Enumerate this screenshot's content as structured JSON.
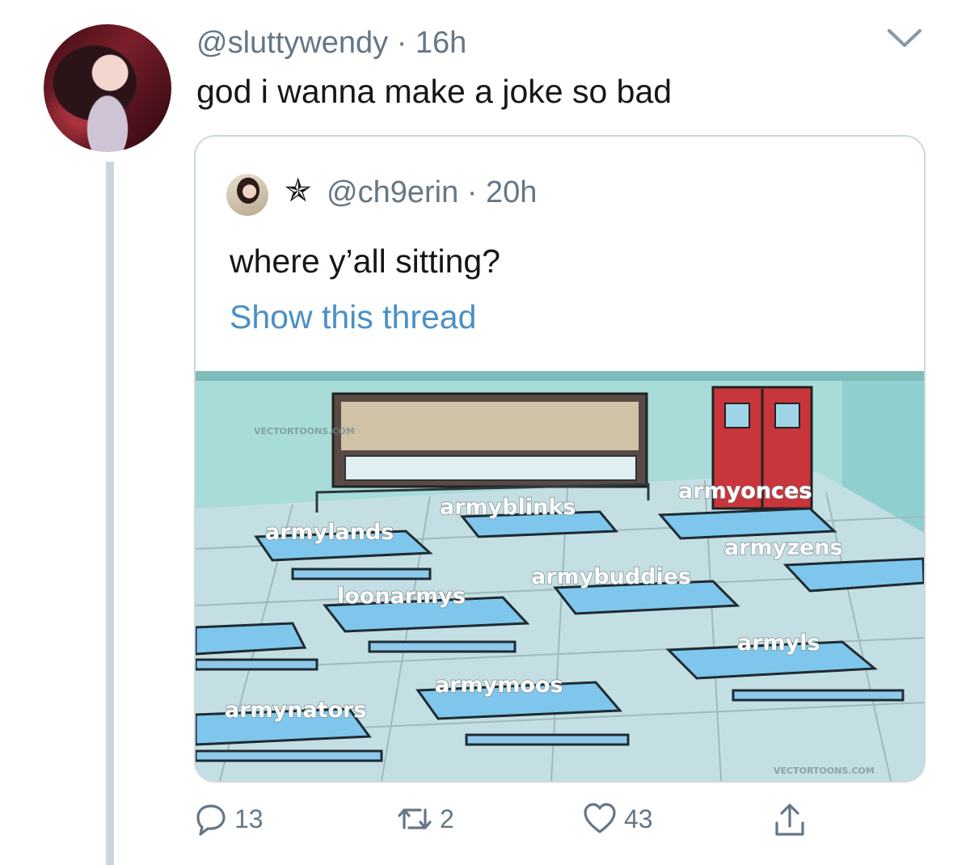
{
  "tweet": {
    "handle": "@sluttywendy",
    "separator": "·",
    "time": "16h",
    "text": "god i wanna make a joke so bad"
  },
  "quoted": {
    "star": "✯",
    "handle": "@ch9erin",
    "separator": "·",
    "time": "20h",
    "text": "where y’all sitting?",
    "show_thread": "Show this thread",
    "image": {
      "labels": {
        "armyonces": "armyonces",
        "armyblinks": "armyblinks",
        "armylands": "armylands",
        "armyzens": "armyzens",
        "armybuddies": "armybuddies",
        "loonarmys": "loonarmys",
        "armyls": "armyls",
        "armymoos": "armymoos",
        "armynators": "armynators"
      },
      "watermark": "VECTORTOONS.COM"
    }
  },
  "actions": {
    "replies": "13",
    "retweets": "2",
    "likes": "43"
  },
  "colors": {
    "text": "#14171a",
    "secondary": "#657786",
    "link": "#4a90c7",
    "border": "#ccd6dd"
  }
}
